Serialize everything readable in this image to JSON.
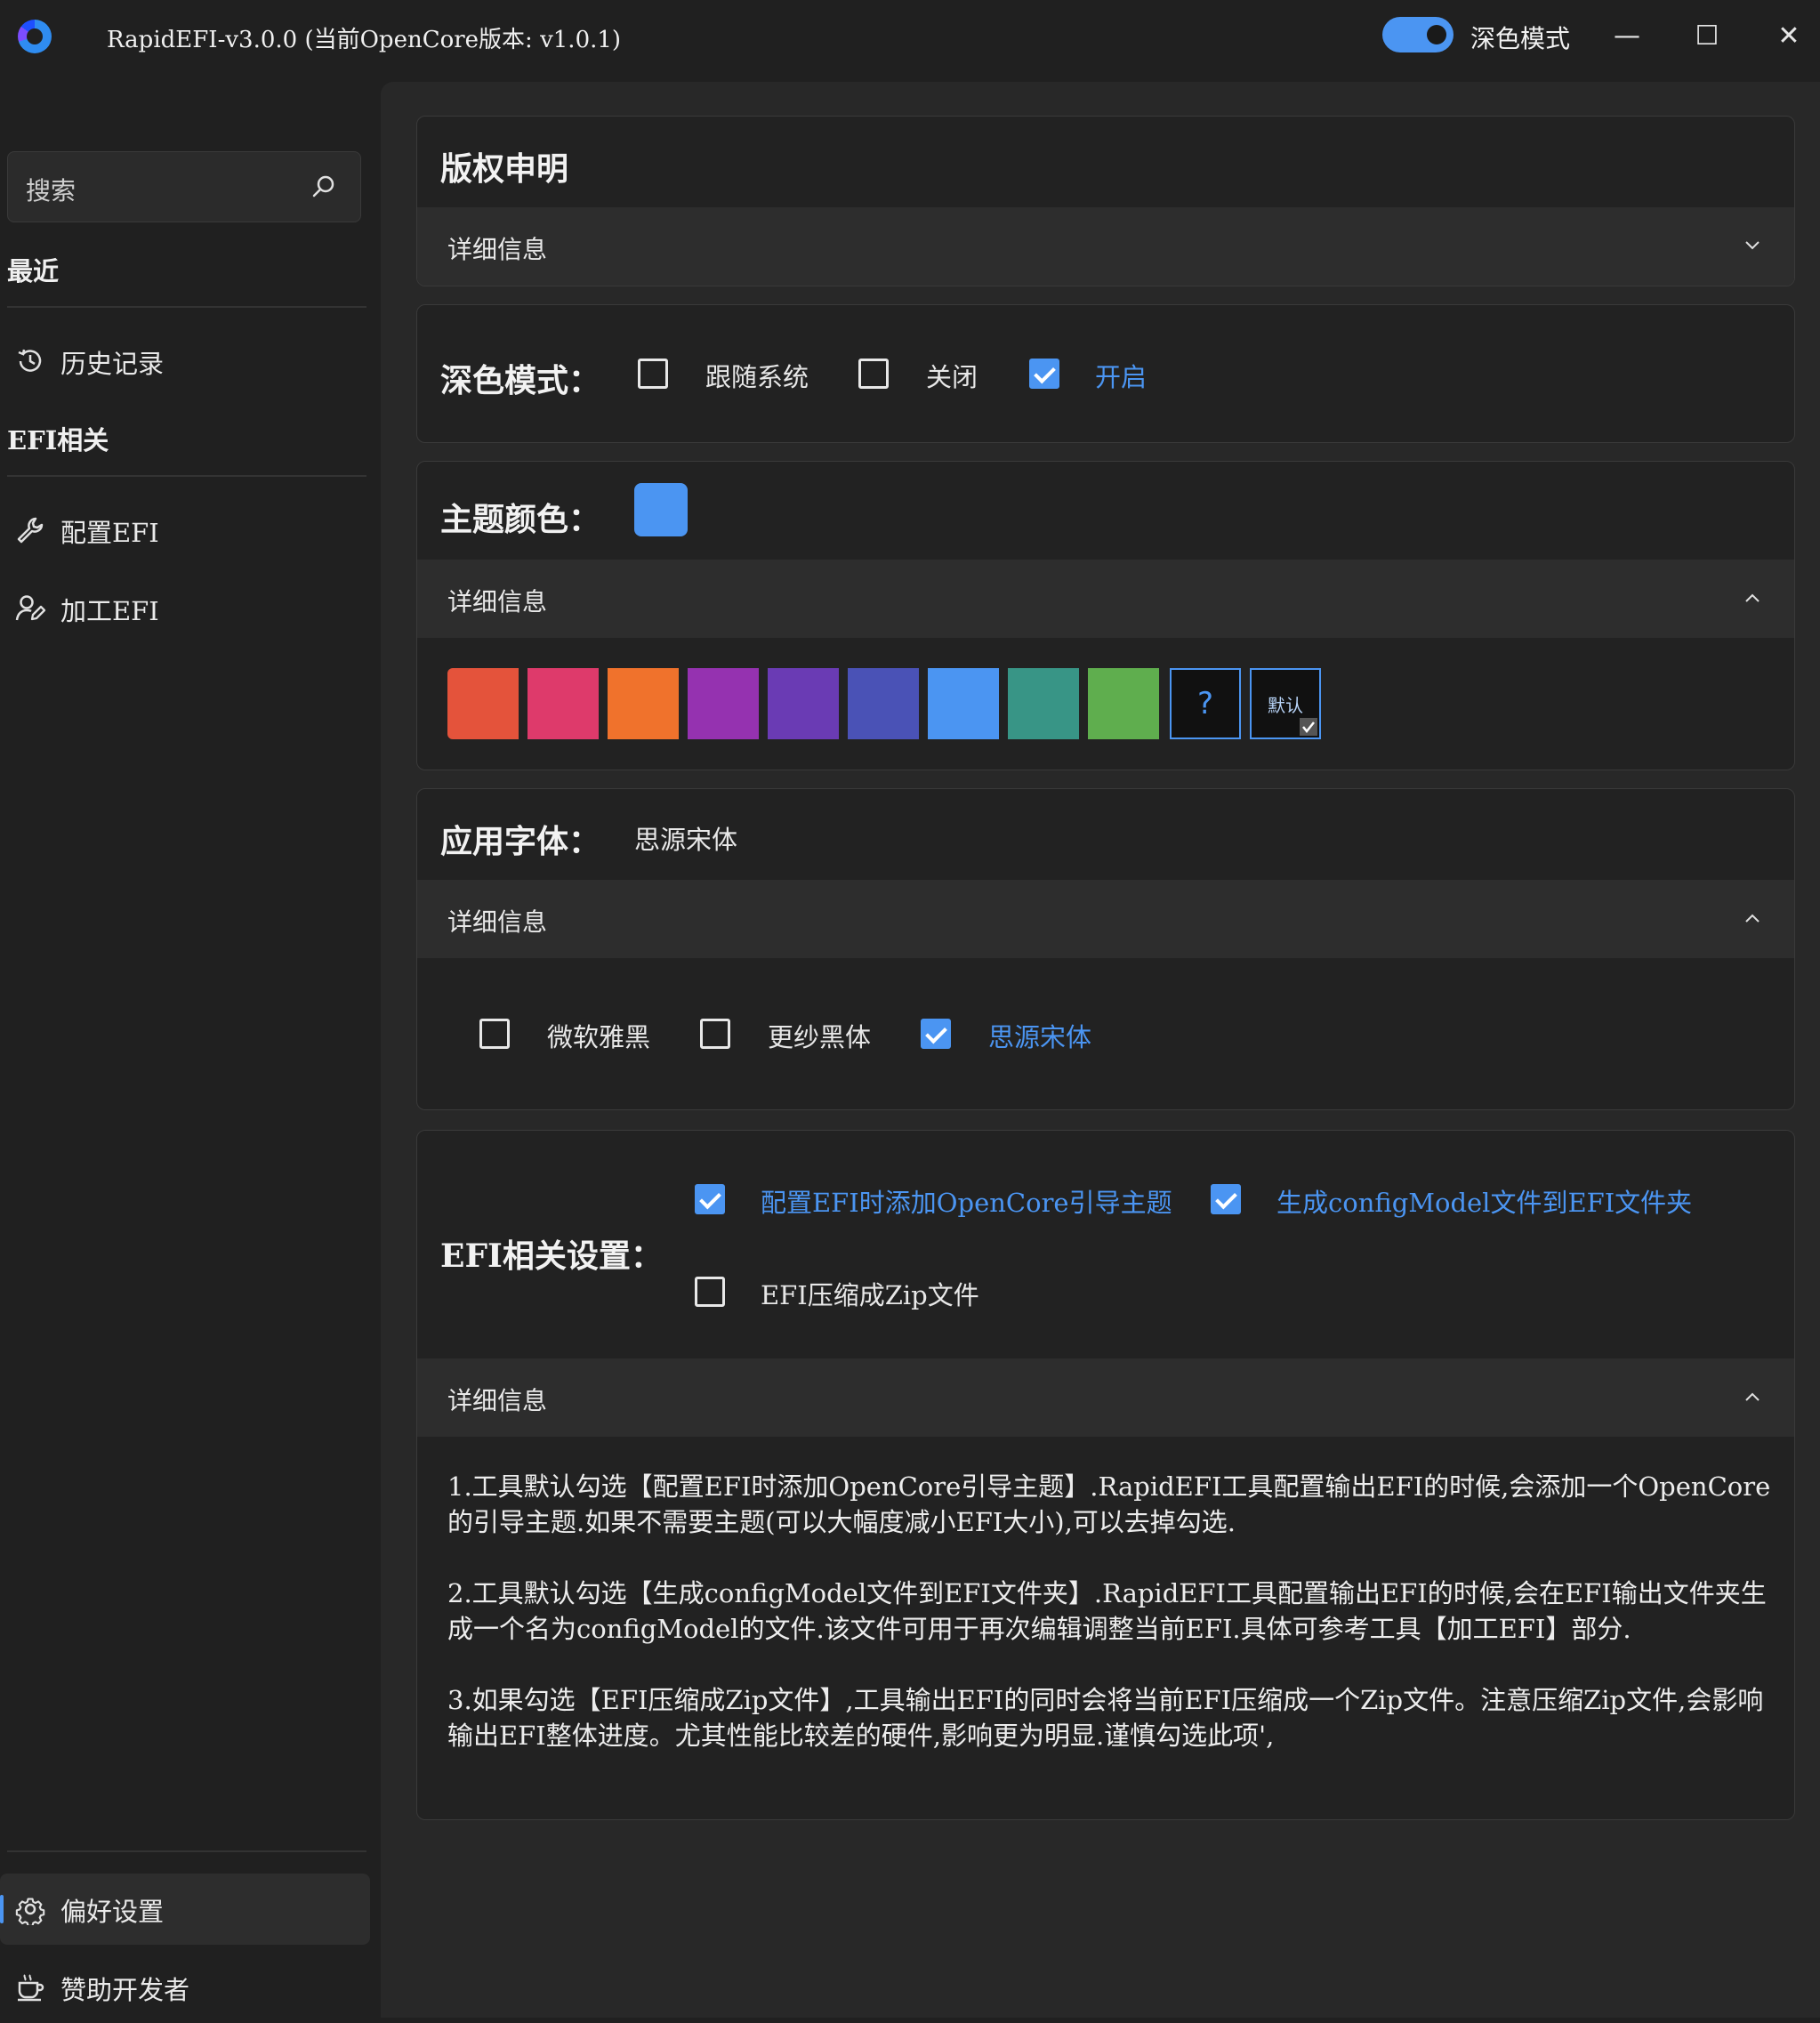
{
  "window": {
    "title": "RapidEFI-v3.0.0 (当前OpenCore版本: v1.0.1)",
    "toggle_label": "深色模式",
    "toggle_on": true,
    "minimize": "—",
    "maximize": "☐",
    "close": "✕"
  },
  "sidebar": {
    "search_placeholder": "搜索",
    "recent_title": "最近",
    "history_label": "历史记录",
    "efi_title": "EFI相关",
    "configure_label": "配置EFI",
    "process_label": "加工EFI",
    "preferences_label": "偏好设置",
    "sponsor_label": "赞助开发者"
  },
  "copyright": {
    "title": "版权申明",
    "details": "详细信息"
  },
  "dark_mode": {
    "title": "深色模式：",
    "options": [
      {
        "label": "跟随系统",
        "checked": false
      },
      {
        "label": "关闭",
        "checked": false
      },
      {
        "label": "开启",
        "checked": true
      }
    ]
  },
  "theme_color": {
    "title": "主题颜色：",
    "current": "#4b95f2",
    "details": "详细信息",
    "swatches": [
      "#e4533b",
      "#de3a6b",
      "#f0722c",
      "#9532b0",
      "#6a3bb4",
      "#4a52b6",
      "#4b95f2",
      "#389586",
      "#5fae4e"
    ],
    "custom_label": "?",
    "default_label": "默认"
  },
  "font": {
    "title": "应用字体：",
    "current": "思源宋体",
    "details": "详细信息",
    "options": [
      {
        "label": "微软雅黑",
        "checked": false
      },
      {
        "label": "更纱黑体",
        "checked": false
      },
      {
        "label": "思源宋体",
        "checked": true
      }
    ]
  },
  "efi_settings": {
    "title": "EFI相关设置：",
    "options": [
      {
        "label": "配置EFI时添加OpenCore引导主题",
        "checked": true
      },
      {
        "label": "生成configModel文件到EFI文件夹",
        "checked": true
      },
      {
        "label": "EFI压缩成Zip文件",
        "checked": false
      }
    ],
    "details": "详细信息",
    "paragraphs": [
      "1.工具默认勾选【配置EFI时添加OpenCore引导主题】.RapidEFI工具配置输出EFI的时候,会添加一个OpenCore的引导主题.如果不需要主题(可以大幅度减小EFI大小),可以去掉勾选.",
      "2.工具默认勾选【生成configModel文件到EFI文件夹】.RapidEFI工具配置输出EFI的时候,会在EFI输出文件夹生成一个名为configModel的文件.该文件可用于再次编辑调整当前EFI.具体可参考工具【加工EFI】部分.",
      "3.如果勾选【EFI压缩成Zip文件】,工具输出EFI的同时会将当前EFI压缩成一个Zip文件。注意压缩Zip文件,会影响输出EFI整体进度。尤其性能比较差的硬件,影响更为明显.谨慎勾选此项',"
    ]
  }
}
